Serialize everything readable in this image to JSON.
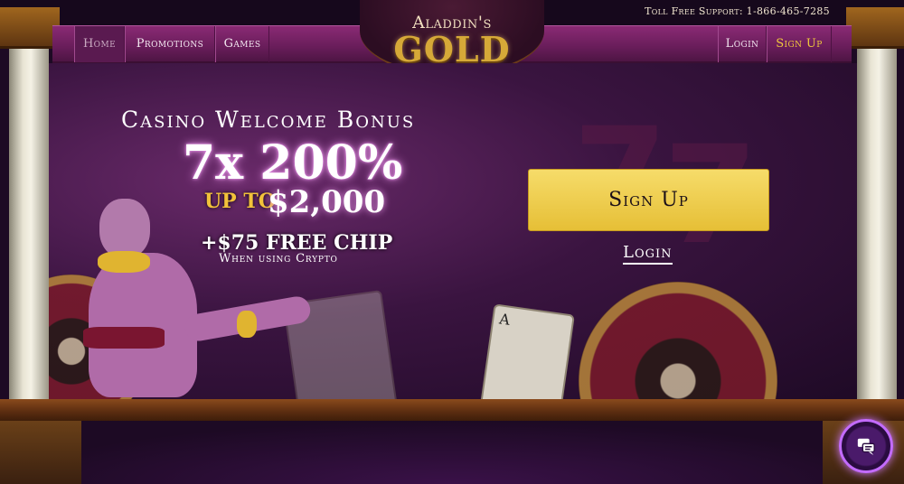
{
  "header": {
    "support_text": "Toll Free Support: 1-866-465-7285",
    "logo_top": "Aladdin's",
    "logo_main": "GOLD"
  },
  "nav": {
    "items": [
      {
        "label": "Home",
        "active": true
      },
      {
        "label": "Promotions"
      },
      {
        "label": "Games"
      }
    ],
    "login_label": "Login",
    "signup_label": "Sign Up"
  },
  "hero": {
    "heading": "Casino Welcome Bonus",
    "main_offer": "7x 200%",
    "up_to": "UP TO",
    "amount": "$2,000",
    "free_chip": "+$75 FREE CHIP",
    "crypto_note": "When using Crypto",
    "signup_button": "Sign Up",
    "login_link": "Login",
    "card_rank": "A"
  },
  "colors": {
    "accent_gold": "#f0c93c",
    "nav_bg": "#6b1e5c",
    "button_yellow": "#f6dc6a",
    "chat_glow": "#c36bff"
  },
  "icons": {
    "chat": "chat-bubbles-icon"
  }
}
